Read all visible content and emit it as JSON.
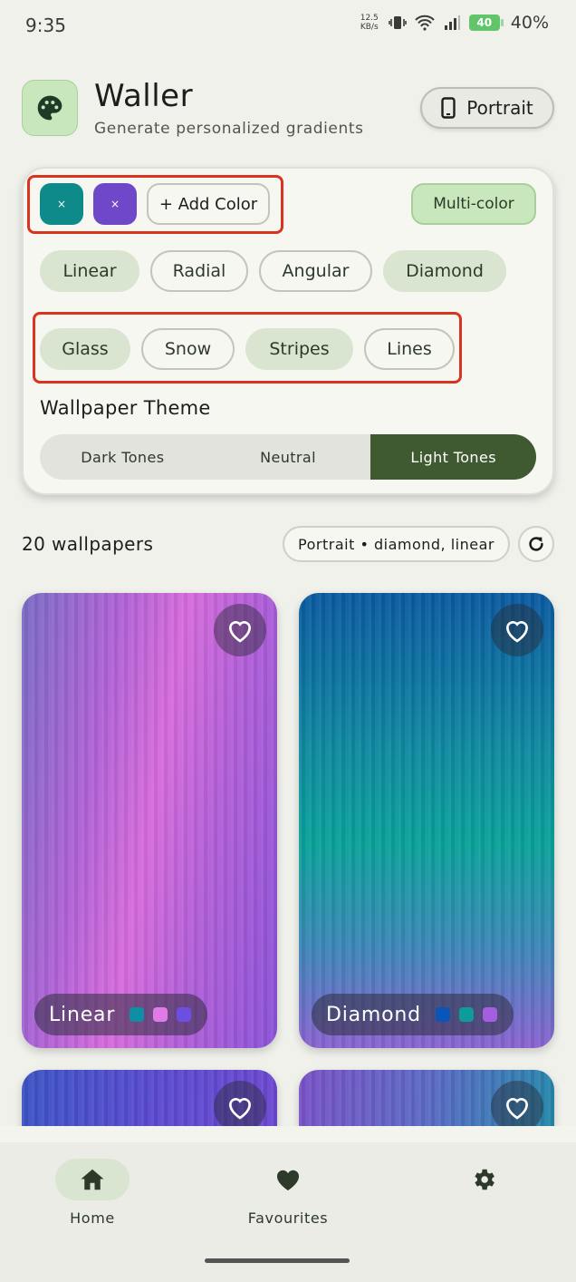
{
  "status_bar": {
    "time": "9:35",
    "net_speed_value": "12.5",
    "net_speed_unit": "KB/s",
    "battery_level": "40",
    "battery_percent": "40%"
  },
  "header": {
    "title": "Waller",
    "subtitle": "Generate personalized gradients",
    "orientation_label": "Portrait"
  },
  "colors": {
    "swatches": [
      {
        "color": "#0e8a8a",
        "remove_label": "×"
      },
      {
        "color": "#6e48c8",
        "remove_label": "×"
      }
    ],
    "add_label": "+ Add Color",
    "mode_label": "Multi-color"
  },
  "gradient_types": [
    "Linear",
    "Radial",
    "Angular",
    "Diamond"
  ],
  "effects": [
    "Glass",
    "Snow",
    "Stripes",
    "Lines"
  ],
  "theme": {
    "title": "Wallpaper Theme",
    "options": [
      "Dark Tones",
      "Neutral",
      "Light Tones"
    ],
    "selected": "Light Tones"
  },
  "results": {
    "count_label": "20 wallpapers",
    "summary": "Portrait • diamond, linear"
  },
  "wallpapers": [
    {
      "name": "Linear",
      "dots": [
        "#0e8fa6",
        "#e07ae6",
        "#6c4fe0"
      ]
    },
    {
      "name": "Diamond",
      "dots": [
        "#0a56b8",
        "#0e9c98",
        "#a55ee0"
      ]
    },
    {
      "name": "",
      "dots": []
    },
    {
      "name": "",
      "dots": []
    }
  ],
  "nav": {
    "home": "Home",
    "favourites": "Favourites",
    "settings": ""
  },
  "accent": "#3f5a31"
}
